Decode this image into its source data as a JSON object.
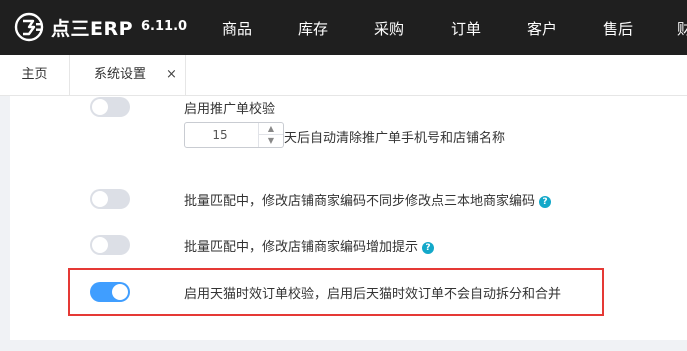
{
  "header": {
    "logo_text": "点三ERP",
    "version": "6.11.0",
    "nav": [
      "商品",
      "库存",
      "采购",
      "订单",
      "客户",
      "售后",
      "财"
    ]
  },
  "tabs": [
    {
      "label": "主页"
    },
    {
      "label": "系统设置",
      "close": "×"
    }
  ],
  "settings": {
    "promo_check_label": "启用推广单校验",
    "promo_days_value": "15",
    "promo_days_suffix": "天后自动清除推广单手机号和店铺名称",
    "batch_no_sync_label": "批量匹配中，修改店铺商家编码不同步修改点三本地商家编码",
    "batch_add_tip_label": "批量匹配中，修改店铺商家编码增加提示",
    "tmall_check_label": "启用天猫时效订单校验，启用后天猫时效订单不会自动拆分和合并",
    "help_glyph": "?"
  },
  "toggle_states": {
    "promo_check": false,
    "batch_no_sync": false,
    "batch_add_tip": false,
    "tmall_check": true
  },
  "colors": {
    "topbar": "#1f1f1f",
    "toggle_on": "#409eff",
    "toggle_off": "#dcdfe6",
    "help_icon": "#13a8c9",
    "highlight": "#e53935"
  }
}
